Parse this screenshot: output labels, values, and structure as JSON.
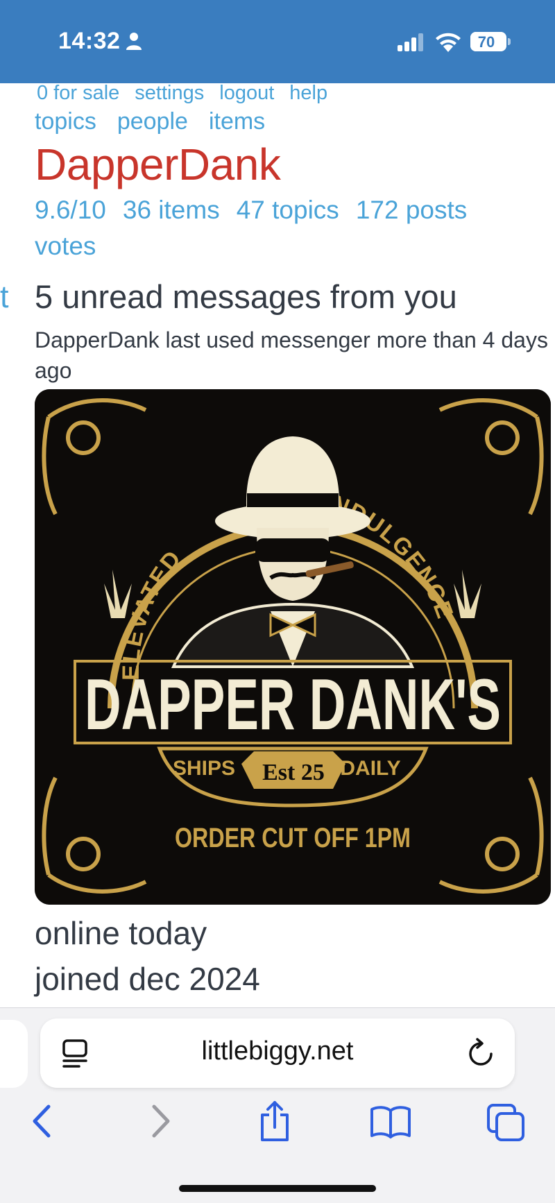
{
  "status_bar": {
    "time": "14:32",
    "battery_level": "70",
    "battery_fraction": 0.7,
    "icons": [
      "person-icon",
      "signal-icon",
      "wifi-icon",
      "battery-icon"
    ],
    "background": "#3a7dbf"
  },
  "nav": {
    "row1": [
      "0 for sale",
      "settings",
      "logout",
      "help"
    ],
    "row2": [
      "topics",
      "people",
      "items"
    ]
  },
  "profile": {
    "username": "DapperDank",
    "rating": "9.6/10",
    "items": "36 items",
    "topics": "47 topics",
    "posts": "172 posts",
    "votes": "votes",
    "left_edge_fragment": "t",
    "unread": "5 unread messages from you",
    "last_used": "DapperDank last used messenger more than 4 days ago",
    "online": "online today",
    "joined": "joined dec 2024"
  },
  "banner": {
    "arc_left": "ELEVATED",
    "arc_right": "INDULGENCE",
    "brand": "DAPPER DANK'S",
    "ships": "SHIPS",
    "est": "Est 25",
    "daily": "DAILY",
    "cutoff": "ORDER CUT OFF 1PM"
  },
  "browser": {
    "url": "littlebiggy.net",
    "icons": [
      "reader-icon",
      "reload-icon",
      "back-icon",
      "forward-icon",
      "share-icon",
      "bookmarks-icon",
      "tabs-icon"
    ]
  },
  "colors": {
    "link": "#4aa3d8",
    "username": "#c8352b",
    "text": "#333a44",
    "gold": "#c9a24a",
    "cream": "#f3ecd4"
  }
}
